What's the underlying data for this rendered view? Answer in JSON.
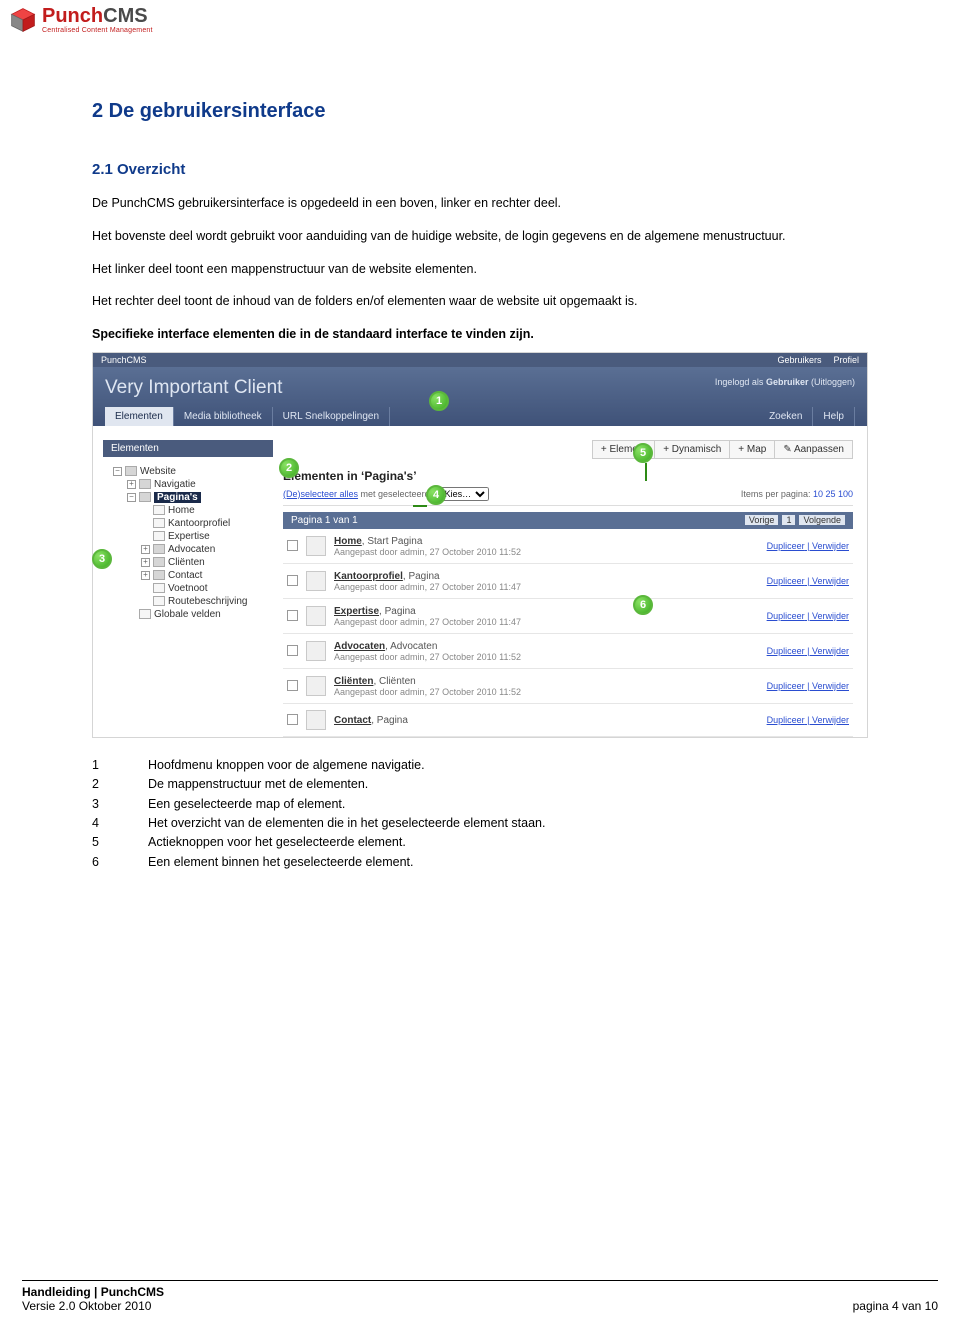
{
  "logo": {
    "brand_first": "Punch",
    "brand_second": "CMS",
    "sub": "Centralised Content Management"
  },
  "headings": {
    "section": "2 De gebruikersinterface",
    "subsection": "2.1 Overzicht"
  },
  "paragraphs": {
    "p1": "De PunchCMS gebruikersinterface is opgedeeld in een boven, linker en rechter deel.",
    "p2": "Het bovenste deel wordt gebruikt voor aanduiding van de huidige website, de login gegevens en de algemene menustructuur.",
    "p3": "Het linker deel toont een mappenstructuur van de website elementen.",
    "p4": "Het rechter deel toont de inhoud van de folders en/of elementen waar de website uit opgemaakt is.",
    "p5": "Specifieke interface elementen die in de standaard interface te vinden zijn."
  },
  "mock": {
    "topbar_left": "PunchCMS",
    "topbar_right": [
      "Gebruikers",
      "Profiel"
    ],
    "header_title": "Very Important Client",
    "login_info_prefix": "Ingelogd als ",
    "login_info_user": "Gebruiker",
    "login_info_suffix": " (Uitloggen)",
    "tabs_left": [
      "Elementen",
      "Media bibliotheek",
      "URL Snelkoppelingen"
    ],
    "tabs_right": [
      "Zoeken",
      "Help"
    ],
    "sidebar_label": "Elementen",
    "tree": {
      "root": "Website",
      "children": [
        {
          "label": "Navigatie",
          "exp": "+"
        },
        {
          "label": "Pagina's",
          "exp": "−",
          "selected": true,
          "children": [
            {
              "label": "Home"
            },
            {
              "label": "Kantoorprofiel"
            },
            {
              "label": "Expertise"
            },
            {
              "label": "Advocaten",
              "exp": "+"
            },
            {
              "label": "Cliënten",
              "exp": "+"
            },
            {
              "label": "Contact",
              "exp": "+"
            },
            {
              "label": "Voetnoot"
            },
            {
              "label": "Routebeschrijving"
            }
          ]
        },
        {
          "label": "Globale velden"
        }
      ]
    },
    "toolbar": [
      "+ Element",
      "+ Dynamisch",
      "+ Map",
      "✎ Aanpassen"
    ],
    "main_title": "Elementen in ‘Pagina's’",
    "select_row_left_prefix": "(De)selecteer alles",
    "select_row_left_mid": " met geselecteerde: ",
    "select_option": "Kies…",
    "ipp_label": "Items per pagina: ",
    "ipp_values": "10 25 100",
    "pager_left": "Pagina 1 van 1",
    "pager_prev": "Vorige",
    "pager_page": "1",
    "pager_next": "Volgende",
    "rows": [
      {
        "name": "Home",
        "type": "Start Pagina",
        "meta": "Aangepast door admin, 27 October 2010 11:52"
      },
      {
        "name": "Kantoorprofiel",
        "type": "Pagina",
        "meta": "Aangepast door admin, 27 October 2010 11:47"
      },
      {
        "name": "Expertise",
        "type": "Pagina",
        "meta": "Aangepast door admin, 27 October 2010 11:47"
      },
      {
        "name": "Advocaten",
        "type": "Advocaten",
        "meta": "Aangepast door admin, 27 October 2010 11:52"
      },
      {
        "name": "Cliënten",
        "type": "Cliënten",
        "meta": "Aangepast door admin, 27 October 2010 11:52"
      },
      {
        "name": "Contact",
        "type": "Pagina",
        "meta": ""
      }
    ],
    "row_action_dup": "Dupliceer",
    "row_action_del": "Verwijder"
  },
  "callouts": {
    "c1": "1",
    "c2": "2",
    "c3": "3",
    "c4": "4",
    "c5": "5",
    "c6": "6"
  },
  "legend": [
    {
      "num": "1",
      "text": "Hoofdmenu knoppen voor de algemene navigatie."
    },
    {
      "num": "2",
      "text": "De mappenstructuur met de elementen."
    },
    {
      "num": "3",
      "text": "Een geselecteerde map of element."
    },
    {
      "num": "4",
      "text": "Het overzicht van de elementen die in het geselecteerde element staan."
    },
    {
      "num": "5",
      "text": "Actieknoppen voor het geselecteerde element."
    },
    {
      "num": "6",
      "text": "Een element binnen het geselecteerde element."
    }
  ],
  "footer": {
    "line1": "Handleiding | PunchCMS",
    "line2": "Versie 2.0  Oktober 2010",
    "page": "pagina 4 van 10"
  }
}
